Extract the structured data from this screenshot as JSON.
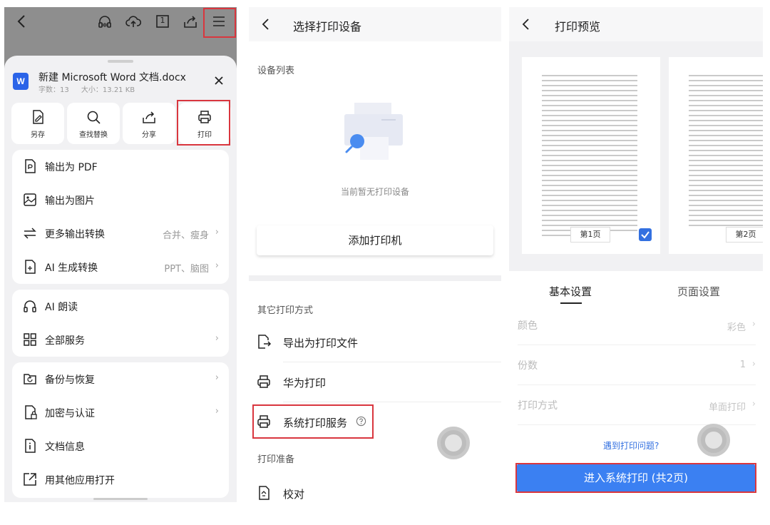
{
  "panel1": {
    "file": {
      "icon_letter": "W",
      "name": "新建 Microsoft Word 文档.docx",
      "meta_words": "字数：13",
      "meta_size": "大小：13.21 KB"
    },
    "top_icons": [
      "back-icon",
      "headphones-icon",
      "cloud-upload-icon",
      "page-count-icon",
      "share-icon",
      "menu-icon"
    ],
    "page_badge": "1",
    "quick_actions": [
      {
        "label": "另存",
        "icon": "save-as-icon"
      },
      {
        "label": "查找替换",
        "icon": "search-icon"
      },
      {
        "label": "分享",
        "icon": "share-icon"
      },
      {
        "label": "打印",
        "icon": "printer-icon"
      }
    ],
    "group1": [
      {
        "label": "输出为 PDF",
        "value": "",
        "arrow": false,
        "icon": "pdf-export-icon"
      },
      {
        "label": "输出为图片",
        "value": "",
        "arrow": false,
        "icon": "image-export-icon"
      },
      {
        "label": "更多输出转换",
        "value": "合并、瘦身",
        "arrow": true,
        "icon": "convert-icon"
      },
      {
        "label": "AI 生成转换",
        "value": "PPT、脑图",
        "arrow": true,
        "icon": "ai-convert-icon"
      }
    ],
    "group2": [
      {
        "label": "AI 朗读",
        "value": "",
        "arrow": false,
        "icon": "headphones-icon"
      },
      {
        "label": "全部服务",
        "value": "",
        "arrow": true,
        "icon": "grid-icon"
      }
    ],
    "group3": [
      {
        "label": "备份与恢复",
        "value": "",
        "arrow": true,
        "icon": "backup-icon"
      },
      {
        "label": "加密与认证",
        "value": "",
        "arrow": true,
        "icon": "lock-doc-icon"
      },
      {
        "label": "文档信息",
        "value": "",
        "arrow": false,
        "icon": "doc-info-icon"
      },
      {
        "label": "用其他应用打开",
        "value": "",
        "arrow": false,
        "icon": "open-external-icon"
      }
    ]
  },
  "panel2": {
    "title": "选择打印设备",
    "device_list_label": "设备列表",
    "empty_text": "当前暂无打印设备",
    "add_printer": "添加打印机",
    "other_label": "其它打印方式",
    "options": [
      {
        "label": "导出为打印文件",
        "icon": "export-file-icon"
      },
      {
        "label": "华为打印",
        "icon": "printer-icon"
      },
      {
        "label": "系统打印服务",
        "icon": "printer-icon"
      }
    ],
    "prep_label": "打印准备",
    "proofread": "校对"
  },
  "panel3": {
    "title": "打印预览",
    "pages": [
      "第1页",
      "第2页"
    ],
    "tabs": [
      "基本设置",
      "页面设置"
    ],
    "settings": [
      {
        "label": "颜色",
        "value": "彩色"
      },
      {
        "label": "份数",
        "value": "1"
      },
      {
        "label": "打印方式",
        "value": "单面打印"
      }
    ],
    "faq": "遇到打印问题?",
    "print_button": "进入系统打印 (共2页)"
  },
  "colors": {
    "highlight_red": "#d9363e",
    "accent_blue": "#3b80f2",
    "word_blue": "#2b64e8"
  }
}
